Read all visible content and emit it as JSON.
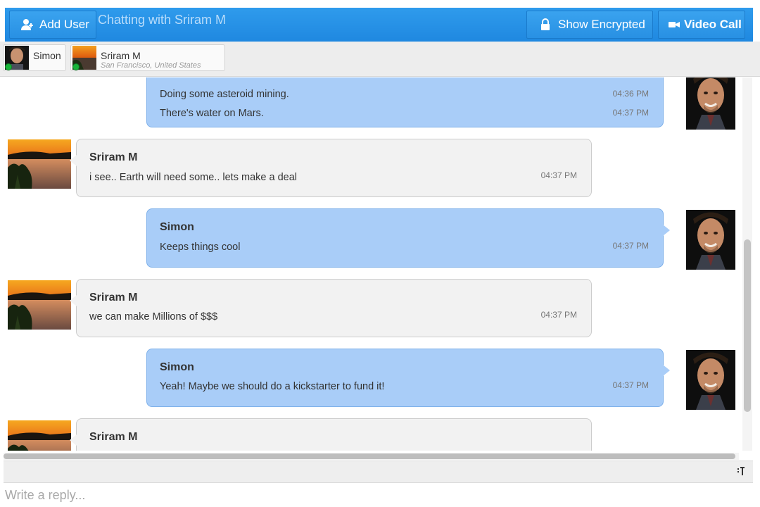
{
  "topbar": {
    "add_user_label": "Add User",
    "chat_title": "Chatting with Sriram M",
    "show_encrypted_label": "Show Encrypted",
    "video_call_label": "Video Call"
  },
  "participants": [
    {
      "name": "Simon",
      "location": "",
      "online": true
    },
    {
      "name": "Sriram M",
      "location": "San Francisco, United States",
      "online": true
    }
  ],
  "messages": [
    {
      "from": "Simon",
      "show_sender": false,
      "lines": [
        {
          "text": "Doing some asteroid mining.",
          "time": "04:36 PM"
        },
        {
          "text": "There's water on Mars.",
          "time": "04:37 PM"
        }
      ]
    },
    {
      "from": "Sriram M",
      "show_sender": true,
      "lines": [
        {
          "text": "i see.. Earth will need some.. lets make a deal",
          "time": "04:37 PM"
        }
      ]
    },
    {
      "from": "Simon",
      "show_sender": true,
      "lines": [
        {
          "text": "Keeps things cool",
          "time": "04:37 PM"
        }
      ]
    },
    {
      "from": "Sriram M",
      "show_sender": true,
      "lines": [
        {
          "text": "we can make Millions of $$$",
          "time": "04:37 PM"
        }
      ]
    },
    {
      "from": "Simon",
      "show_sender": true,
      "lines": [
        {
          "text": "Yeah! Maybe we should do a kickstarter to fund it!",
          "time": "04:37 PM"
        }
      ]
    },
    {
      "from": "Sriram M",
      "show_sender": true,
      "lines": []
    }
  ],
  "reply": {
    "placeholder": "Write a reply..."
  },
  "colors": {
    "accent": "#1f88e0",
    "own_bubble": "#a9cdf8",
    "other_bubble": "#f2f2f2",
    "online": "#19b33a"
  }
}
